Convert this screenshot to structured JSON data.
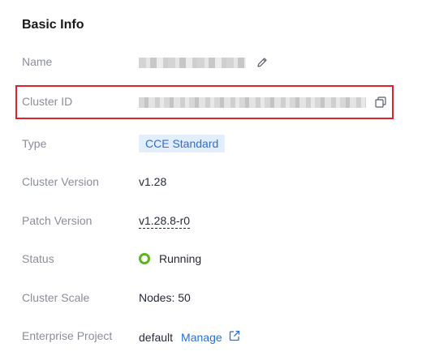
{
  "section": {
    "title": "Basic Info"
  },
  "fields": {
    "name": {
      "label": "Name"
    },
    "cluster_id": {
      "label": "Cluster ID"
    },
    "type": {
      "label": "Type",
      "value": "CCE Standard"
    },
    "cluster_version": {
      "label": "Cluster Version",
      "value": "v1.28"
    },
    "patch_version": {
      "label": "Patch Version",
      "value": "v1.28.8-r0"
    },
    "status": {
      "label": "Status",
      "value": "Running",
      "color": "#5bb718"
    },
    "cluster_scale": {
      "label": "Cluster Scale",
      "value": "Nodes: 50"
    },
    "enterprise_project": {
      "label": "Enterprise Project",
      "value": "default",
      "link": "Manage"
    }
  },
  "icons": {
    "edit": "pencil-icon",
    "copy": "copy-icon",
    "external": "external-link-icon"
  },
  "colors": {
    "highlight": "#d9262c",
    "accent": "#2c6fd6",
    "tag_bg": "#e3eefc"
  }
}
